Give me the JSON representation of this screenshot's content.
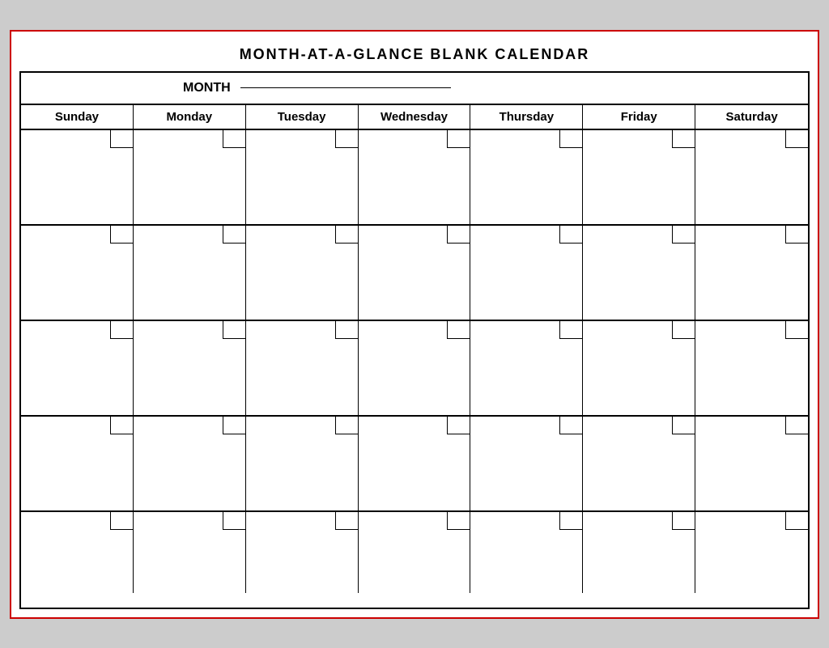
{
  "page": {
    "title": "MONTH-AT-A-GLANCE  BLANK  CALENDAR",
    "month_label": "MONTH",
    "days": [
      "Sunday",
      "Monday",
      "Tuesday",
      "Wednesday",
      "Thursday",
      "Friday",
      "Saturday"
    ],
    "rows": 5
  }
}
